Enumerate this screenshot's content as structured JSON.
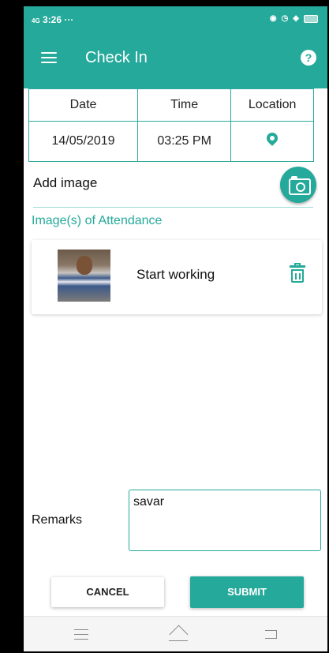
{
  "status_bar": {
    "time": "3:26",
    "signal": "4G",
    "extra": "···",
    "icons": [
      "location-icon",
      "alarm-icon",
      "wifi-icon",
      "battery-icon"
    ]
  },
  "header": {
    "title": "Check In",
    "menu_icon": "hamburger-menu-icon",
    "help_icon": "help-icon",
    "help_glyph": "?"
  },
  "info_table": {
    "headers": [
      "Date",
      "Time",
      "Location"
    ],
    "date": "14/05/2019",
    "time": "03:25 PM",
    "location_icon": "map-pin-icon"
  },
  "add_image": {
    "label": "Add image",
    "camera_icon": "camera-icon"
  },
  "images_section": {
    "title": "Image(s) of Attendance",
    "items": [
      {
        "caption": "Start working",
        "thumbnail": "person-photo",
        "delete_icon": "trash-icon"
      }
    ]
  },
  "remarks": {
    "label": "Remarks",
    "value": "savar"
  },
  "actions": {
    "cancel_label": "CANCEL",
    "submit_label": "SUBMIT"
  },
  "colors": {
    "accent": "#25a99a",
    "background": "#ffffff"
  }
}
